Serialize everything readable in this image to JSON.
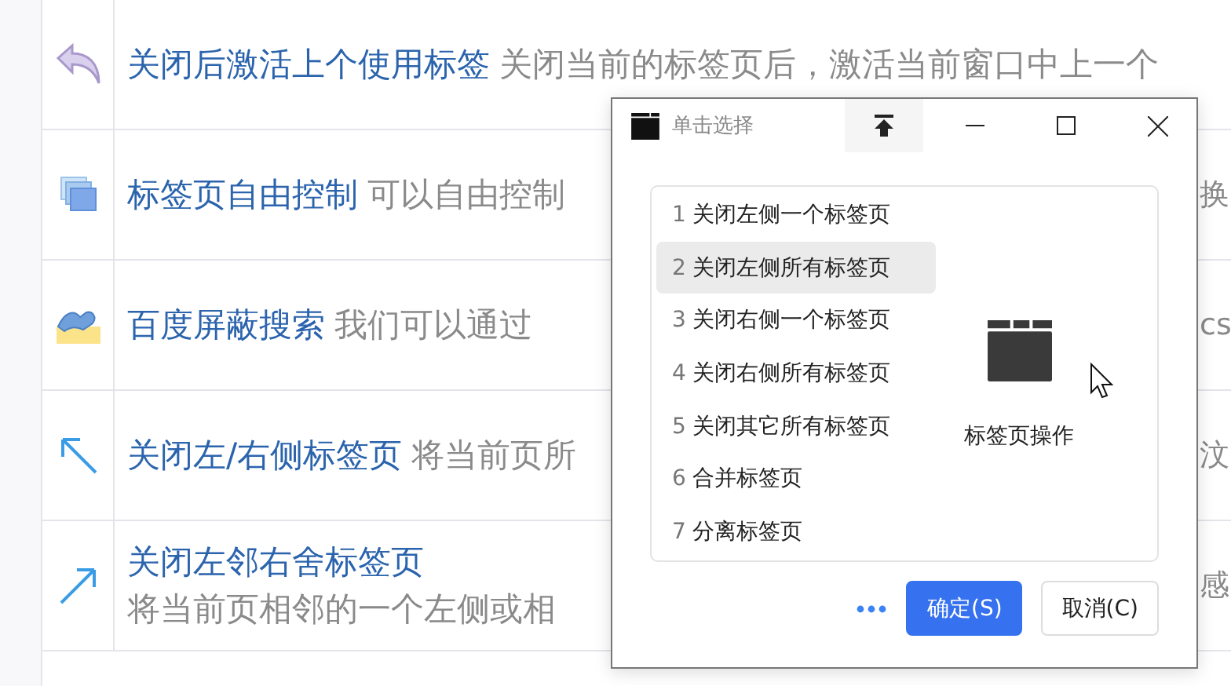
{
  "features": [
    {
      "kind": "inline",
      "title": "关闭后激活上个使用标签",
      "description": "关闭当前的标签页后，激活当前窗口中上一个"
    },
    {
      "kind": "inline",
      "title": "标签页自由控制",
      "description": "可以自由控制",
      "fragment": "换"
    },
    {
      "kind": "inline",
      "title": "百度屏蔽搜索",
      "description": "我们可以通过",
      "fragment": "cs"
    },
    {
      "kind": "inline",
      "title": "关闭左/右侧标签页",
      "description": "将当前页所",
      "fragment": "汶"
    },
    {
      "kind": "stacked",
      "title": "关闭左邻右舍标签页",
      "description": "将当前页相邻的一个左侧或相",
      "fragment": "感"
    }
  ],
  "dialog": {
    "title": "单击选择",
    "items": [
      {
        "number": "1",
        "label": "关闭左侧一个标签页",
        "selected": false
      },
      {
        "number": "2",
        "label": "关闭左侧所有标签页",
        "selected": true
      },
      {
        "number": "3",
        "label": "关闭右侧一个标签页",
        "selected": false
      },
      {
        "number": "4",
        "label": "关闭右侧所有标签页",
        "selected": false
      },
      {
        "number": "5",
        "label": "关闭其它所有标签页",
        "selected": false
      },
      {
        "number": "6",
        "label": "合并标签页",
        "selected": false
      },
      {
        "number": "7",
        "label": "分离标签页",
        "selected": false
      }
    ],
    "preview_label": "标签页操作",
    "buttons": [
      {
        "kind": "primary",
        "label": "确定(S)"
      },
      {
        "kind": "default",
        "label": "取消(C)"
      }
    ]
  }
}
